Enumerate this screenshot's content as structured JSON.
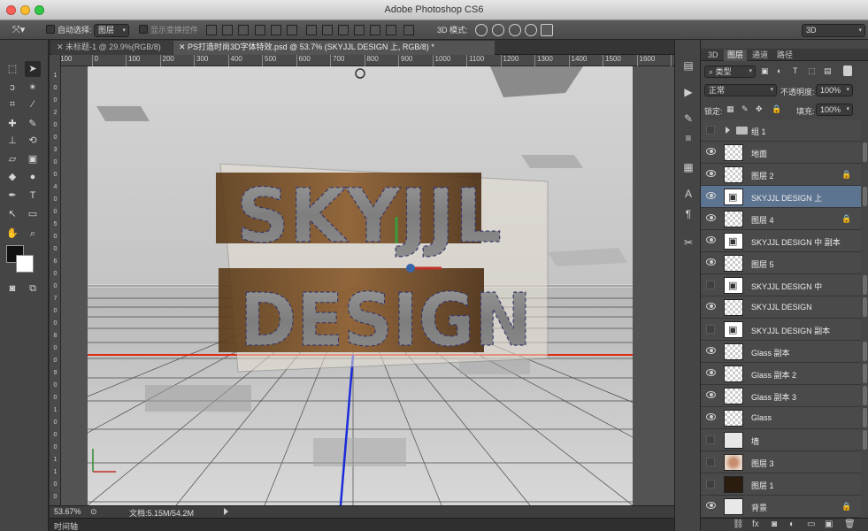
{
  "window": {
    "title": "Adobe Photoshop CS6"
  },
  "options_bar": {
    "auto_select_label": "自动选择:",
    "auto_select_value": "图层",
    "show_transform_label": "显示变换控件",
    "mode_3d_label": "3D 模式:",
    "workspace": "3D"
  },
  "doc_tabs": [
    {
      "label": "未标题-1 @ 29.9%(RGB/8)"
    },
    {
      "label": "PS打造时尚3D字体特效.psd @ 53.7% (SKYJJL DESIGN 上, RGB/8) *"
    }
  ],
  "ruler": {
    "h_ticks": [
      "100",
      "0",
      "100",
      "200",
      "300",
      "400",
      "500",
      "600",
      "700",
      "800",
      "900",
      "1000",
      "1100",
      "1200",
      "1300",
      "1400",
      "1500",
      "1600",
      "1700"
    ],
    "v_ticks": [
      "1",
      "0",
      "0",
      "2",
      "0",
      "0",
      "3",
      "0",
      "0",
      "4",
      "0",
      "0",
      "5",
      "0",
      "0",
      "6",
      "0",
      "0",
      "7",
      "0",
      "0",
      "8",
      "0",
      "0",
      "9",
      "0",
      "0",
      "1",
      "0",
      "0",
      "0",
      "1",
      "1",
      "0",
      "0"
    ]
  },
  "canvas": {
    "headline_line1": "SKYJJL",
    "headline_line2": "DESIGN"
  },
  "status": {
    "zoom": "53.67%",
    "doc_info": "文档:5.15M/54.2M",
    "timeline": "时间轴"
  },
  "panel": {
    "tabs": [
      "3D",
      "图层",
      "通道",
      "路径"
    ],
    "active_tab": "图层",
    "filter_kind": "类型",
    "blend_mode": "正常",
    "opacity_label": "不透明度:",
    "opacity_value": "100%",
    "lock_label": "锁定:",
    "fill_label": "填充:",
    "fill_value": "100%"
  },
  "layers": [
    {
      "name": "组 1",
      "visible": false,
      "kind": "group",
      "locked": false,
      "selected": false,
      "fx": false
    },
    {
      "name": "地面",
      "visible": true,
      "kind": "transparent",
      "locked": false,
      "selected": false,
      "fx": true
    },
    {
      "name": "图层 2",
      "visible": true,
      "kind": "transparent",
      "locked": true,
      "selected": false,
      "fx": false
    },
    {
      "name": "SKYJJL DESIGN 上",
      "visible": true,
      "kind": "text",
      "locked": false,
      "selected": true,
      "fx": true
    },
    {
      "name": "图层 4",
      "visible": true,
      "kind": "transparent",
      "locked": true,
      "selected": false,
      "fx": false
    },
    {
      "name": "SKYJJL DESIGN 中 副本",
      "visible": true,
      "kind": "text",
      "locked": false,
      "selected": false,
      "fx": false
    },
    {
      "name": "图层 5",
      "visible": true,
      "kind": "transparent",
      "locked": false,
      "selected": false,
      "fx": false
    },
    {
      "name": "SKYJJL DESIGN 中",
      "visible": false,
      "kind": "text",
      "locked": false,
      "selected": false,
      "fx": true
    },
    {
      "name": "SKYJJL DESIGN",
      "visible": true,
      "kind": "transparent",
      "locked": false,
      "selected": false,
      "fx": true
    },
    {
      "name": "SKYJJL DESIGN 副本",
      "visible": false,
      "kind": "text",
      "locked": false,
      "selected": false,
      "fx": false
    },
    {
      "name": "Glass 副本",
      "visible": true,
      "kind": "transparent",
      "locked": false,
      "selected": false,
      "fx": true
    },
    {
      "name": "Glass 副本 2",
      "visible": true,
      "kind": "transparent",
      "locked": false,
      "selected": false,
      "fx": true
    },
    {
      "name": "Glass 副本 3",
      "visible": true,
      "kind": "transparent",
      "locked": false,
      "selected": false,
      "fx": true
    },
    {
      "name": "Glass",
      "visible": true,
      "kind": "transparent",
      "locked": false,
      "selected": false,
      "fx": true
    },
    {
      "name": "墙",
      "visible": false,
      "kind": "solidwhite",
      "locked": false,
      "selected": false,
      "fx": true
    },
    {
      "name": "图层 3",
      "visible": false,
      "kind": "flesh",
      "locked": false,
      "selected": false,
      "fx": false
    },
    {
      "name": "图层 1",
      "visible": false,
      "kind": "dark",
      "locked": false,
      "selected": false,
      "fx": false
    },
    {
      "name": "背景",
      "visible": true,
      "kind": "solidwhite",
      "locked": true,
      "selected": false,
      "fx": false
    }
  ],
  "colors": {
    "selection_blue": "#5d7490",
    "horizon_red": "#e02a12",
    "axis_blue": "#1a2bd8"
  }
}
